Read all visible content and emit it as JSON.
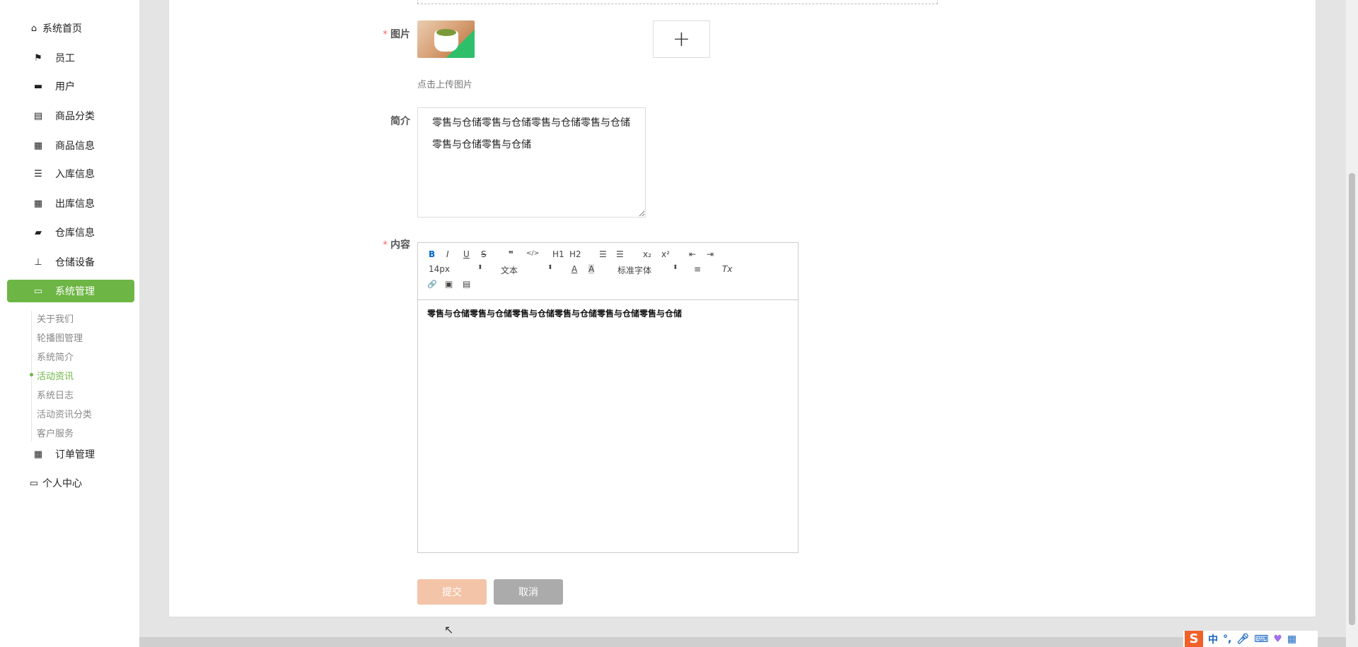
{
  "sidebar": {
    "home": "系统首页",
    "items": [
      {
        "label": "员工",
        "icon": "flag-icon"
      },
      {
        "label": "用户",
        "icon": "briefcase-icon"
      },
      {
        "label": "商品分类",
        "icon": "clipboard-icon"
      },
      {
        "label": "商品信息",
        "icon": "grid-icon"
      },
      {
        "label": "入库信息",
        "icon": "list-icon"
      },
      {
        "label": "出库信息",
        "icon": "grid-icon"
      },
      {
        "label": "仓库信息",
        "icon": "wallet-icon"
      },
      {
        "label": "仓储设备",
        "icon": "user-icon"
      },
      {
        "label": "系统管理",
        "icon": "monitor-icon"
      }
    ],
    "sub_items": [
      "关于我们",
      "轮播图管理",
      "系统简介",
      "活动资讯",
      "系统日志",
      "活动资讯分类",
      "客户服务"
    ],
    "active_sub": "活动资讯",
    "order": "订单管理",
    "personal": "个人中心"
  },
  "form": {
    "image_label": "图片",
    "required_mark": "*",
    "upload_hint": "点击上传图片",
    "plus": "+",
    "summary_label": "简介",
    "summary_value": "零售与仓储零售与仓储零售与仓储零售与仓储零售与仓储零售与仓储",
    "content_label": "内容",
    "editor": {
      "toolbar": {
        "bold": "B",
        "italic": "I",
        "underline": "U",
        "strike": "S",
        "quote": "❞",
        "code": "</>",
        "h1": "H1",
        "h2": "H2",
        "ol": "☰",
        "ul": "☰",
        "sub": "x₂",
        "sup": "x²",
        "outdent": "⇤",
        "indent": "⇥",
        "size": "14px",
        "header": "文本",
        "color": "A",
        "bg": "A",
        "font": "标准字体",
        "align": "≡",
        "clean": "Tx",
        "link": "🔗",
        "image": "▣",
        "video": "▤"
      },
      "content": "零售与仓储零售与仓储零售与仓储零售与仓储零售与仓储零售与仓储"
    },
    "submit": "提交",
    "cancel": "取消"
  },
  "ime": {
    "logo": "S",
    "mode": "中",
    "punct": "°,"
  },
  "colors": {
    "accent": "#6db544",
    "submit": "#f4c4a8",
    "cancel": "#ababab"
  }
}
